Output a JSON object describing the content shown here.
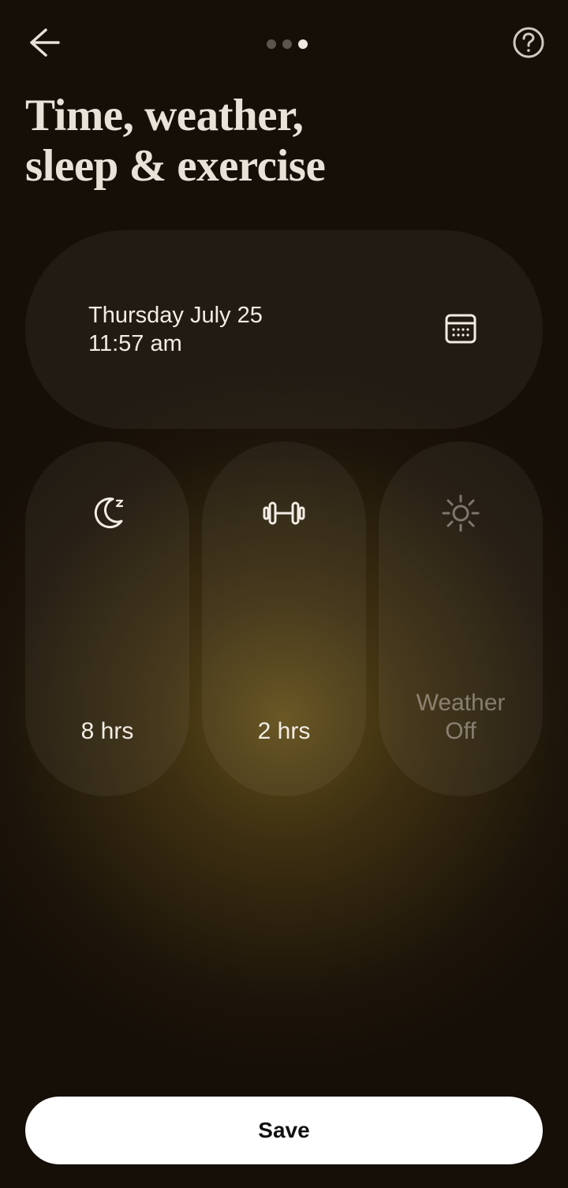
{
  "header": {
    "pager": {
      "count": 3,
      "active_index": 2
    }
  },
  "title_line1": "Time, weather,",
  "title_line2": "sleep & exercise",
  "datetime": {
    "date": "Thursday July 25",
    "time": "11:57 am"
  },
  "sleep": {
    "value": "8 hrs"
  },
  "exercise": {
    "value": "2 hrs"
  },
  "weather": {
    "line1": "Weather",
    "line2": "Off"
  },
  "icons": {
    "back": "arrow-left-icon",
    "help": "help-icon",
    "calendar": "calendar-icon",
    "moon": "moon-sleep-icon",
    "dumbbell": "dumbbell-icon",
    "sun": "sun-icon"
  },
  "save_label": "Save"
}
